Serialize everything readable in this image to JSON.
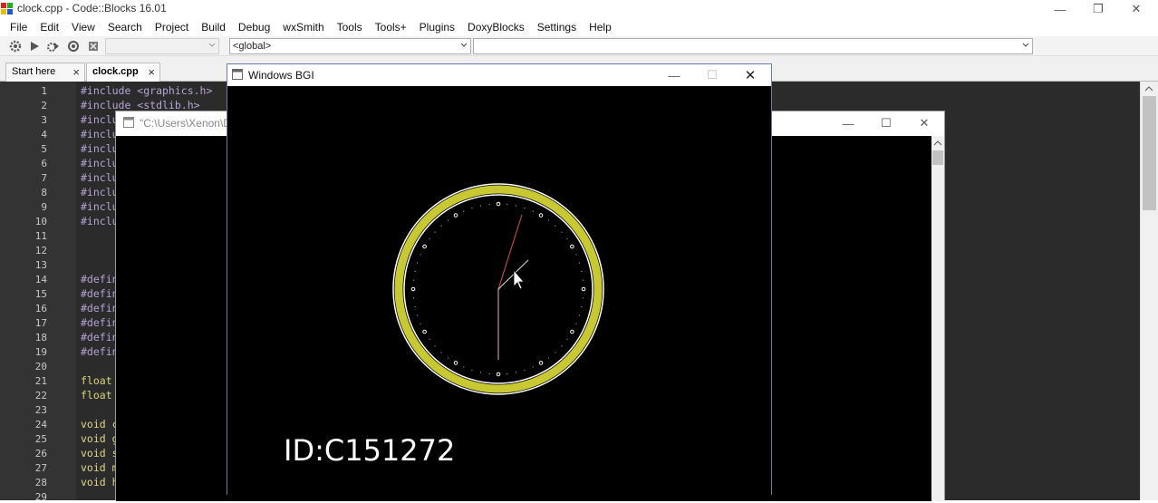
{
  "window": {
    "title": "clock.cpp - Code::Blocks 16.01"
  },
  "menu": [
    "File",
    "Edit",
    "View",
    "Search",
    "Project",
    "Build",
    "Debug",
    "wxSmith",
    "Tools",
    "Tools+",
    "Plugins",
    "DoxyBlocks",
    "Settings",
    "Help"
  ],
  "toolbar": {
    "scope_combo": "<global>",
    "target_combo": "",
    "symbol_combo": ""
  },
  "tabs": [
    {
      "label": "Start here",
      "active": false
    },
    {
      "label": "clock.cpp",
      "active": true
    }
  ],
  "editor": {
    "lines": [
      {
        "n": "1",
        "code": "#include <graphics.h>"
      },
      {
        "n": "2",
        "code": "#include <stdlib.h>"
      },
      {
        "n": "3",
        "code": "#inclu"
      },
      {
        "n": "4",
        "code": "#inclu"
      },
      {
        "n": "5",
        "code": "#inclu"
      },
      {
        "n": "6",
        "code": "#inclu"
      },
      {
        "n": "7",
        "code": "#inclu"
      },
      {
        "n": "8",
        "code": "#inclu"
      },
      {
        "n": "9",
        "code": "#inclu"
      },
      {
        "n": "10",
        "code": "#inclu"
      },
      {
        "n": "11",
        "code": ""
      },
      {
        "n": "12",
        "code": ""
      },
      {
        "n": "13",
        "code": ""
      },
      {
        "n": "14",
        "code": "#defin"
      },
      {
        "n": "15",
        "code": "#defin"
      },
      {
        "n": "16",
        "code": "#defin"
      },
      {
        "n": "17",
        "code": "#defin"
      },
      {
        "n": "18",
        "code": "#defin"
      },
      {
        "n": "19",
        "code": "#defin"
      },
      {
        "n": "20",
        "code": ""
      },
      {
        "n": "21",
        "code": "float"
      },
      {
        "n": "22",
        "code": "float"
      },
      {
        "n": "23",
        "code": ""
      },
      {
        "n": "24",
        "code": "void c"
      },
      {
        "n": "25",
        "code": "void g"
      },
      {
        "n": "26",
        "code": "void s"
      },
      {
        "n": "27",
        "code": "void m"
      },
      {
        "n": "28",
        "code": "void h"
      },
      {
        "n": "29",
        "code": ""
      }
    ]
  },
  "console": {
    "title": "\"C:\\Users\\Xenon\\D"
  },
  "bgi": {
    "title": "Windows BGI",
    "id_label": "ID:C151272"
  },
  "colors": {
    "editor_bg": "#2b2b2b",
    "gutter_bg": "#333333",
    "preproc": "#b8a3d6",
    "keyword_float": "#d6d67a",
    "keyword_void": "#e0d68a",
    "clock_ring": "#c8c832",
    "hand_red": "#e05050",
    "hand_white": "#ffffff"
  },
  "icons": [
    "codeblocks-app-icon",
    "minimize-icon",
    "restore-icon",
    "close-icon",
    "gear-icon",
    "run-icon",
    "build-run-icon",
    "rebuild-icon",
    "stop-icon",
    "chevron-down-icon",
    "console-window-icon",
    "bgi-window-icon",
    "cursor-icon"
  ]
}
